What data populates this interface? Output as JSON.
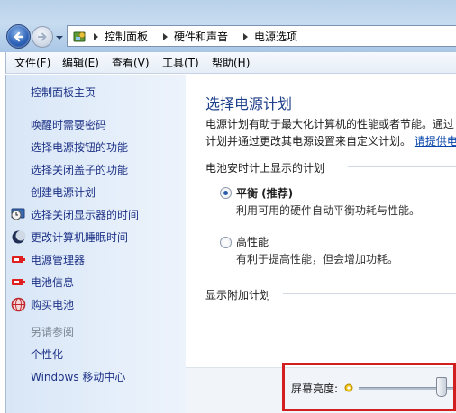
{
  "address_bar": {
    "crumbs": [
      "控制面板",
      "硬件和声音",
      "电源选项"
    ]
  },
  "menu": [
    "文件(F)",
    "编辑(E)",
    "查看(V)",
    "工具(T)",
    "帮助(H)"
  ],
  "sidebar": {
    "home": "控制面板主页",
    "links": [
      {
        "label": "唤醒时需要密码",
        "icon": ""
      },
      {
        "label": "选择电源按钮的功能",
        "icon": ""
      },
      {
        "label": "选择关闭盖子的功能",
        "icon": ""
      },
      {
        "label": "创建电源计划",
        "icon": ""
      },
      {
        "label": "选择关闭显示器的时间",
        "icon": "display-clock-icon"
      },
      {
        "label": "更改计算机睡眠时间",
        "icon": "moon-icon"
      },
      {
        "label": "电源管理器",
        "icon": "battery-red-icon"
      },
      {
        "label": "电池信息",
        "icon": "battery-red-icon"
      },
      {
        "label": "购买电池",
        "icon": "globe-icon"
      }
    ],
    "see_also_heading": "另请参阅",
    "see_also": [
      "个性化",
      "Windows 移动中心"
    ]
  },
  "main": {
    "title": "选择电源计划",
    "desc_line1": "电源计划有助于最大化计算机的性能或者节能。通过",
    "desc_line2": "计划并通过更改其电源设置来自定义计划。",
    "desc_link": "请提供电",
    "section_battery": "电池安时计上显示的计划",
    "plans": [
      {
        "name": "平衡 (推荐)",
        "desc": "利用可用的硬件自动平衡功耗与性能。",
        "selected": true
      },
      {
        "name": "高性能",
        "desc": "有利于提高性能，但会增加功耗。",
        "selected": false
      }
    ],
    "section_more": "显示附加计划"
  },
  "brightness": {
    "label": "屏幕亮度:",
    "level": 0.85
  },
  "colors": {
    "accent": "#1e3f8a",
    "link": "#1e3287",
    "highlight": "#d21e1e"
  }
}
